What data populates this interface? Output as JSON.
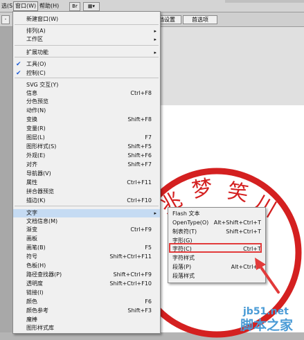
{
  "menubar": {
    "items": [
      {
        "label": "选(S)"
      },
      {
        "label": "窗口(W)",
        "active": true
      },
      {
        "label": "帮助(H)"
      }
    ],
    "btn_br": "Br",
    "btn_layout": "▦▾"
  },
  "control_bar": {
    "small_label": "-",
    "document_setup": "文档设置",
    "preferences": "首选项"
  },
  "window_menu": {
    "items": [
      {
        "label": "新建窗口(W)"
      },
      {
        "label": "排列(A)",
        "submenu": true
      },
      {
        "label": "工作区",
        "submenu": true
      },
      {
        "label": "扩展功能",
        "submenu": true
      },
      {
        "label": "工具(O)",
        "checked": true
      },
      {
        "label": "控制(C)",
        "checked": true
      },
      {
        "label": "SVG 交互(Y)"
      },
      {
        "label": "信息",
        "shortcut": "Ctrl+F8"
      },
      {
        "label": "分色预览"
      },
      {
        "label": "动作(N)"
      },
      {
        "label": "变换",
        "shortcut": "Shift+F8"
      },
      {
        "label": "变量(R)"
      },
      {
        "label": "图层(L)",
        "shortcut": "F7"
      },
      {
        "label": "图形样式(S)",
        "shortcut": "Shift+F5"
      },
      {
        "label": "外观(E)",
        "shortcut": "Shift+F6"
      },
      {
        "label": "对齐",
        "shortcut": "Shift+F7"
      },
      {
        "label": "导航器(V)"
      },
      {
        "label": "属性",
        "shortcut": "Ctrl+F11"
      },
      {
        "label": "拼合器预览"
      },
      {
        "label": "描边(K)",
        "shortcut": "Ctrl+F10"
      },
      {
        "label": "文字",
        "submenu": true,
        "highlighted": true
      },
      {
        "label": "文档信息(M)"
      },
      {
        "label": "渐变",
        "shortcut": "Ctrl+F9"
      },
      {
        "label": "画板"
      },
      {
        "label": "画笔(B)",
        "shortcut": "F5"
      },
      {
        "label": "符号",
        "shortcut": "Shift+Ctrl+F11"
      },
      {
        "label": "色板(H)"
      },
      {
        "label": "路径查找器(P)",
        "shortcut": "Shift+Ctrl+F9"
      },
      {
        "label": "透明度",
        "shortcut": "Shift+Ctrl+F10"
      },
      {
        "label": "链接(I)"
      },
      {
        "label": "颜色",
        "shortcut": "F6"
      },
      {
        "label": "颜色参考",
        "shortcut": "Shift+F3"
      },
      {
        "label": "魔棒"
      },
      {
        "label": "图形样式库"
      }
    ]
  },
  "text_submenu": {
    "items": [
      {
        "label": "Flash 文本"
      },
      {
        "label": "OpenType(O)",
        "shortcut": "Alt+Shift+Ctrl+T"
      },
      {
        "label": "制表符(T)",
        "shortcut": "Shift+Ctrl+T"
      },
      {
        "label": "字形(G)"
      },
      {
        "label": "字符(C)",
        "shortcut": "Ctrl+T"
      },
      {
        "label": "字符样式"
      },
      {
        "label": "段落(P)",
        "shortcut": "Alt+Ctrl+T"
      },
      {
        "label": "段落样式"
      }
    ]
  },
  "stamp": {
    "text": "梦 笑",
    "color": "#d42020"
  },
  "annotation": {
    "box_color": "#e23a3a",
    "arrow_color": "#e23a3a"
  },
  "watermark": {
    "url": "jb51.net",
    "site_name": "脚本之家"
  }
}
